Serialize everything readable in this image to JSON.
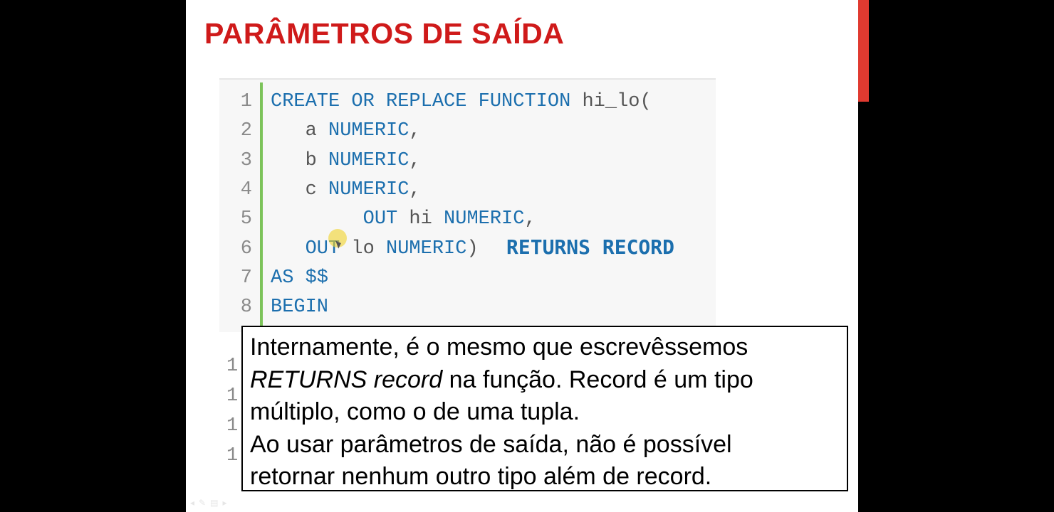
{
  "slide": {
    "title": "PARÂMETROS DE SAÍDA",
    "colors": {
      "title": "#cf1a1a",
      "accent_bar": "#e03a30",
      "keyword": "#1c6fae",
      "identifier": "#555555",
      "line_number": "#8a8a8a",
      "gutter_bar": "#7cc35a",
      "returns_overlay": "#1c6fae"
    },
    "code": {
      "lines": [
        {
          "num": "1",
          "text": "CREATE OR REPLACE FUNCTION hi_lo("
        },
        {
          "num": "2",
          "text": "   a NUMERIC,"
        },
        {
          "num": "3",
          "text": "   b NUMERIC,"
        },
        {
          "num": "4",
          "text": "   c NUMERIC,"
        },
        {
          "num": "5",
          "text": "        OUT hi NUMERIC,"
        },
        {
          "num": "6",
          "text": "   OUT lo NUMERIC)"
        },
        {
          "num": "7",
          "text": "AS $$"
        },
        {
          "num": "8",
          "text": "BEGIN"
        }
      ],
      "obscured_line_numbers": [
        "1",
        "1",
        "1",
        "1"
      ],
      "returns_overlay": "RETURNS RECORD"
    },
    "note": {
      "line1": "Internamente, é o mesmo que escrevêssemos",
      "line2_italic": "RETURNS record",
      "line2_rest": " na função. Record é um tipo",
      "line3": "múltiplo, como o de uma tupla.",
      "line4": "Ao usar parâmetros de saída, não é possível",
      "line5": "retornar nenhum outro tipo além de record."
    },
    "controls": {
      "icons": [
        "prev-slide-icon",
        "pen-icon",
        "menu-icon",
        "next-slide-icon"
      ]
    }
  }
}
